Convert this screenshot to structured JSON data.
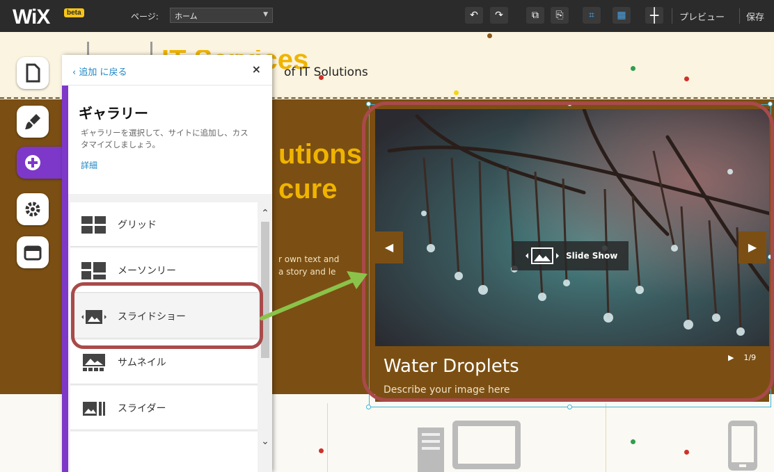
{
  "toolbar": {
    "logo": "WiX",
    "beta": "beta",
    "page_label": "ページ:",
    "page_value": "ホーム",
    "preview": "プレビュー",
    "save": "保存"
  },
  "site": {
    "title": "IT Services",
    "subtitle": "of IT Solutions",
    "band_line1": "utions",
    "band_line2": "cure",
    "band_small1": "r own text and",
    "band_small2": "a story and le"
  },
  "panel": {
    "back": "追加 に戻る",
    "close": "×",
    "title": "ギャラリー",
    "desc": "ギャラリーを選択して、サイトに追加し、カスタマイズしましょう。",
    "more": "詳細",
    "items": [
      {
        "label": "グリッド",
        "icon": "grid-gallery-icon"
      },
      {
        "label": "メーソンリー",
        "icon": "masonry-gallery-icon"
      },
      {
        "label": "スライドショー",
        "icon": "slideshow-gallery-icon"
      },
      {
        "label": "サムネイル",
        "icon": "thumbnail-gallery-icon"
      },
      {
        "label": "スライダー",
        "icon": "slider-gallery-icon"
      }
    ]
  },
  "slideshow": {
    "badge": "Slide Show",
    "caption_title": "Water Droplets",
    "caption_desc": "Describe your image here",
    "counter": "1/9"
  },
  "colors": {
    "accent": "#7d38c9",
    "brown": "#7b4f13",
    "gold": "#f0b400",
    "highlight": "#a94a4a",
    "arrow": "#8bc34a"
  }
}
